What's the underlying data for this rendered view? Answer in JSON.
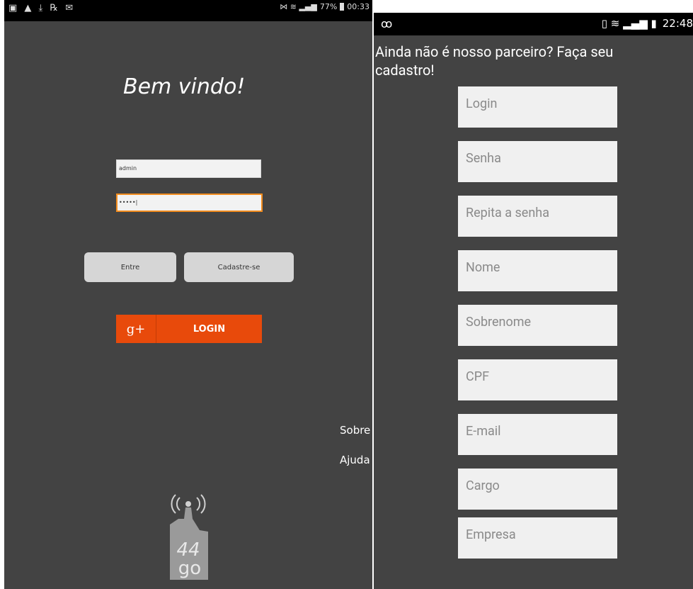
{
  "left": {
    "status_bar": {
      "icons_left": "▣ ▲ ⤓ ℞ ✉",
      "icons_right": "⋈ ≋ ▂▄▆",
      "battery": "77%",
      "time": "00:33"
    },
    "welcome": "Bem vindo!",
    "username_value": "admin",
    "password_value": "•••••|",
    "enter_label": "Entre",
    "register_label": "Cadastre-se",
    "google_glyph": "g+",
    "google_login_label": "LOGIN",
    "menu": {
      "about": "Sobre",
      "help": "Ajuda"
    },
    "logo_text": "44 go",
    "logo_signal": "((•))"
  },
  "right": {
    "status_bar": {
      "voicemail": "ꝏ",
      "icons": "▯ ≋ ▂▄▆ ▮",
      "time": "22:48"
    },
    "invite": "Ainda não é nosso parceiro? Faça seu cadastro!",
    "fields": [
      {
        "placeholder": "Login"
      },
      {
        "placeholder": "Senha"
      },
      {
        "placeholder": "Repita a senha"
      },
      {
        "placeholder": "Nome"
      },
      {
        "placeholder": "Sobrenome"
      },
      {
        "placeholder": "CPF"
      },
      {
        "placeholder": "E-mail"
      },
      {
        "placeholder": "Cargo"
      },
      {
        "placeholder": "Empresa"
      }
    ]
  },
  "colors": {
    "background": "#434343",
    "google_red": "#e84a0b",
    "focus_orange": "#f28c1e",
    "button_gray": "#d6d6d6"
  }
}
